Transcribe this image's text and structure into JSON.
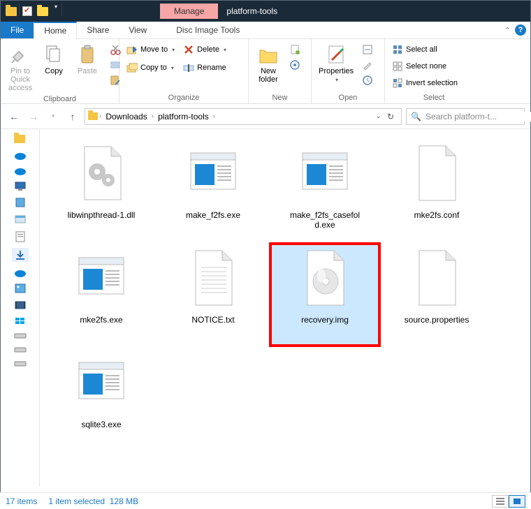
{
  "title": "platform-tools",
  "context_tab": "Manage",
  "menus": {
    "file": "File",
    "home": "Home",
    "share": "Share",
    "view": "View",
    "disc": "Disc Image Tools"
  },
  "ribbon": {
    "clipboard": {
      "label": "Clipboard",
      "pin": "Pin to Quick\naccess",
      "copy": "Copy",
      "paste": "Paste"
    },
    "organize": {
      "label": "Organize",
      "moveto": "Move to",
      "copyto": "Copy to",
      "delete": "Delete",
      "rename": "Rename"
    },
    "new": {
      "label": "New",
      "newfolder": "New\nfolder"
    },
    "open": {
      "label": "Open",
      "properties": "Properties"
    },
    "select": {
      "label": "Select",
      "all": "Select all",
      "none": "Select none",
      "invert": "Invert selection"
    }
  },
  "breadcrumb": {
    "a": "Downloads",
    "b": "platform-tools"
  },
  "search_placeholder": "Search platform-t...",
  "files": [
    {
      "name": "libwinpthread-1.dll",
      "type": "dll"
    },
    {
      "name": "make_f2fs.exe",
      "type": "exe"
    },
    {
      "name": "make_f2fs_casefold.exe",
      "type": "exe"
    },
    {
      "name": "mke2fs.conf",
      "type": "generic"
    },
    {
      "name": "mke2fs.exe",
      "type": "exe"
    },
    {
      "name": "NOTICE.txt",
      "type": "txt"
    },
    {
      "name": "recovery.img",
      "type": "img",
      "selected": true,
      "highlight": true
    },
    {
      "name": "source.properties",
      "type": "generic"
    },
    {
      "name": "sqlite3.exe",
      "type": "exe"
    }
  ],
  "status": {
    "count": "17 items",
    "selection": "1 item selected",
    "size": "128 MB"
  }
}
